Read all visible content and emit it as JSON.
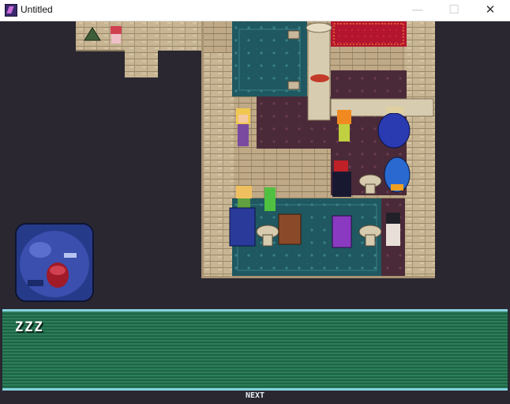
{
  "window": {
    "title": "Untitled",
    "minimize_icon": "minimize-icon",
    "maximize_icon": "maximize-icon",
    "close_icon": "close-icon",
    "minimize_glyph": "—",
    "maximize_glyph": "☐",
    "close_glyph": "✕"
  },
  "dialog": {
    "message": "ZZZ",
    "next_label": "NEXT",
    "speaker_portrait": "sleeping-blue-beast-portrait"
  },
  "scene": {
    "characters": [
      "blonde-girl",
      "orange-haired-girl",
      "blue-dragon",
      "red-haired-caped-figure",
      "blue-dragon-2",
      "blonde-girl-2",
      "green-fairy",
      "blue-beast",
      "brown-bird-creature",
      "purple-hooded-figure",
      "dark-haired-boy",
      "red-haired-girl"
    ]
  },
  "colors": {
    "stone": "#c8b593",
    "carpet_teal": "#1f5860",
    "carpet_maroon": "#4a2a38",
    "rug_red": "#b4152e",
    "textbox_green": "#2c7e57",
    "textbox_border": "#86d3df"
  }
}
